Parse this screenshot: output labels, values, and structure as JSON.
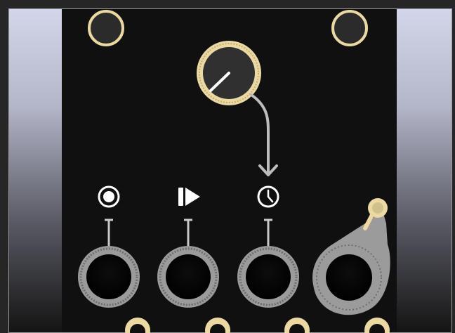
{
  "colors": {
    "background": "#262626",
    "panel": "#101010",
    "accent_ring": "#ebd9a1",
    "jack_ring": "#9b9b9b",
    "white": "#ffffff",
    "cable": "#bdbdbd"
  },
  "module": {
    "mount_holes": [
      "mount-hole-left",
      "mount-hole-right"
    ],
    "knob": {
      "icon": "knob-icon"
    },
    "buttons": [
      {
        "id": "record",
        "icon": "record-icon"
      },
      {
        "id": "play",
        "icon": "play-pause-icon"
      },
      {
        "id": "clock",
        "icon": "clock-icon"
      }
    ],
    "jacks": [
      "record-jack",
      "play-jack",
      "clock-jack",
      "output-jack"
    ],
    "bottom_jacks": [
      "bottom-jack-1",
      "bottom-jack-2",
      "bottom-jack-3",
      "bottom-jack-4"
    ]
  }
}
